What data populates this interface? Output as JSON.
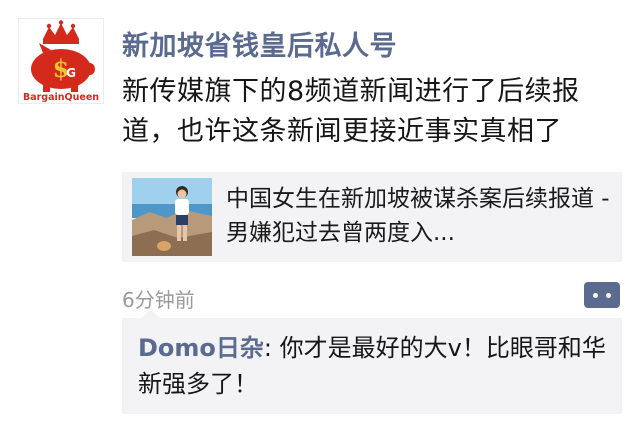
{
  "post": {
    "avatar": {
      "logo_text": "BargainQueen",
      "icon": "pig-with-crown-logo"
    },
    "author": "新加坡省钱皇后私人号",
    "text": "新传媒旗下的8频道新闻进行了后续报道，也许这条新闻更接近事实真相了",
    "timestamp": "6分钟前"
  },
  "link_card": {
    "title": "中国女生在新加坡被谋杀案后续报道 - 男嫌犯过去曾两度入..."
  },
  "comment": {
    "author": "Domo日杂",
    "separator": ": ",
    "text": "你才是最好的大v！比眼哥和华新强多了！"
  },
  "colors": {
    "accent": "#5b6a8f",
    "logo_red": "#d42a1c",
    "card_bg": "#f3f3f5"
  }
}
